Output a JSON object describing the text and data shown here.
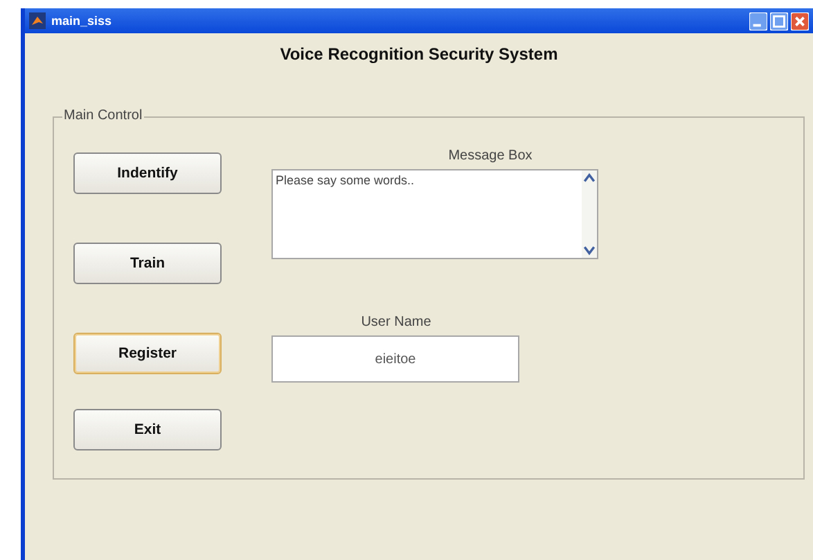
{
  "window": {
    "title": "main_siss"
  },
  "heading": "Voice Recognition Security System",
  "main_control": {
    "title": "Main Control",
    "buttons": [
      {
        "label": "Indentify",
        "focused": false
      },
      {
        "label": "Train",
        "focused": false
      },
      {
        "label": "Register",
        "focused": true
      },
      {
        "label": "Exit",
        "focused": false
      }
    ],
    "message_box": {
      "label": "Message Box",
      "value": "Please say some words.."
    },
    "user_name": {
      "label": "User Name",
      "value": "eieitoe"
    }
  }
}
